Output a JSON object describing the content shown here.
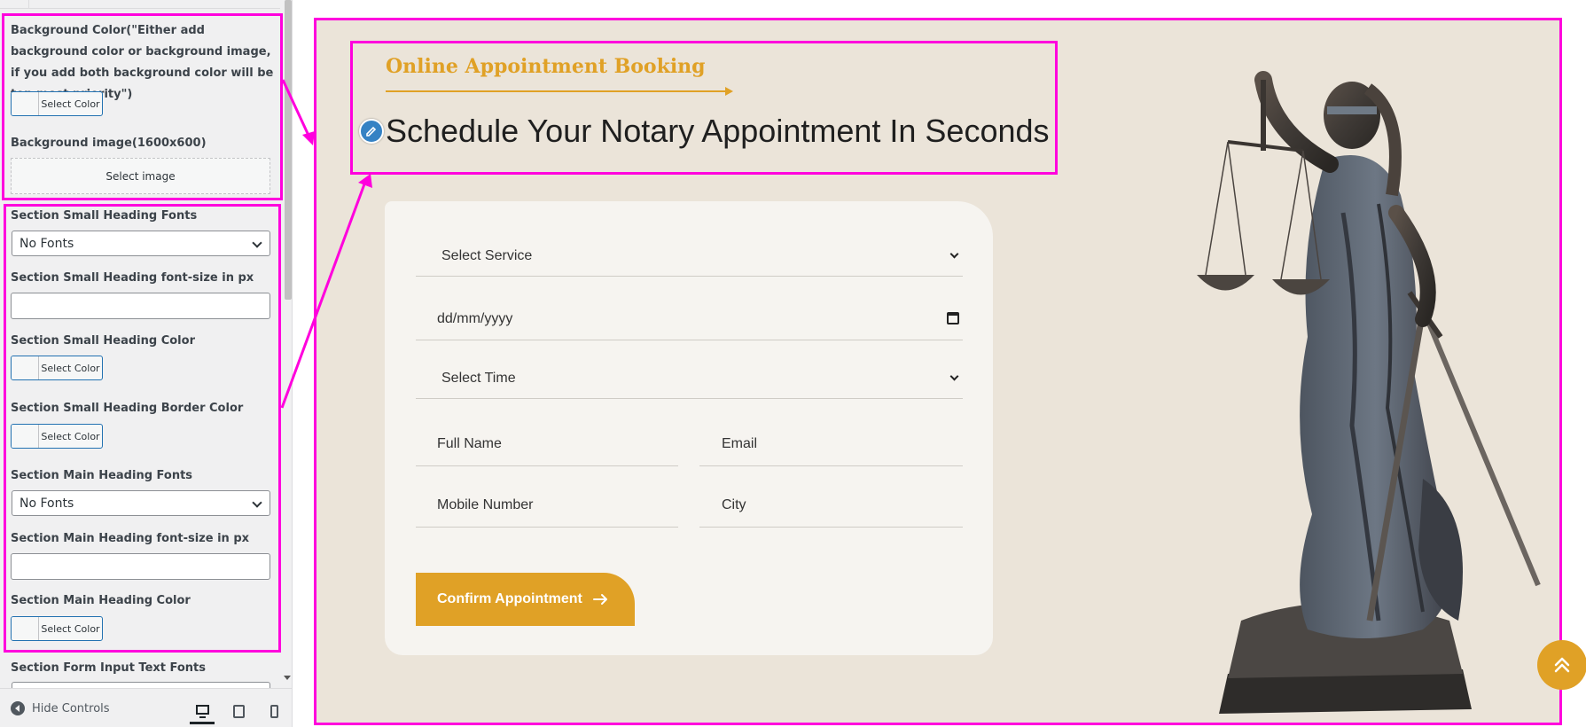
{
  "sidebar": {
    "bg_color_label": "Background Color(\"Either add background color or background image, if you add both background color will be top most priority\")",
    "bg_color_button": "Select Color",
    "bg_image_label": "Background image(1600x600)",
    "bg_image_button": "Select image",
    "small_heading_fonts_label": "Section Small Heading Fonts",
    "small_heading_fonts_value": "No Fonts",
    "small_heading_size_label": "Section Small Heading font-size in px",
    "small_heading_color_label": "Section Small Heading Color",
    "small_heading_color_button": "Select Color",
    "small_heading_border_label": "Section Small Heading Border Color",
    "small_heading_border_button": "Select Color",
    "main_heading_fonts_label": "Section Main Heading Fonts",
    "main_heading_fonts_value": "No Fonts",
    "main_heading_size_label": "Section Main Heading font-size in px",
    "main_heading_color_label": "Section Main Heading Color",
    "main_heading_color_button": "Select Color",
    "form_input_fonts_label": "Section Form Input Text Fonts",
    "hide_controls": "Hide Controls"
  },
  "preview": {
    "small_heading": "Online Appointment Booking",
    "main_heading": "Schedule Your Notary Appointment In Seconds",
    "form": {
      "service": "Select Service",
      "date_placeholder": "dd/mm/yyyy",
      "time": "Select Time",
      "full_name": "Full Name",
      "email": "Email",
      "mobile": "Mobile Number",
      "city": "City",
      "submit": "Confirm Appointment"
    }
  },
  "colors": {
    "accent": "#e0a126",
    "highlight": "#ff00dd",
    "section_bg": "#ebe4d9",
    "card_bg": "#f6f4f0",
    "edit_icon": "#3582c4"
  },
  "icons": [
    "pencil-icon",
    "arrow-right-icon",
    "chevron-down-icon",
    "calendar-icon",
    "double-chevron-up-icon",
    "collapse-icon",
    "desktop-icon",
    "tablet-icon",
    "mobile-icon"
  ]
}
